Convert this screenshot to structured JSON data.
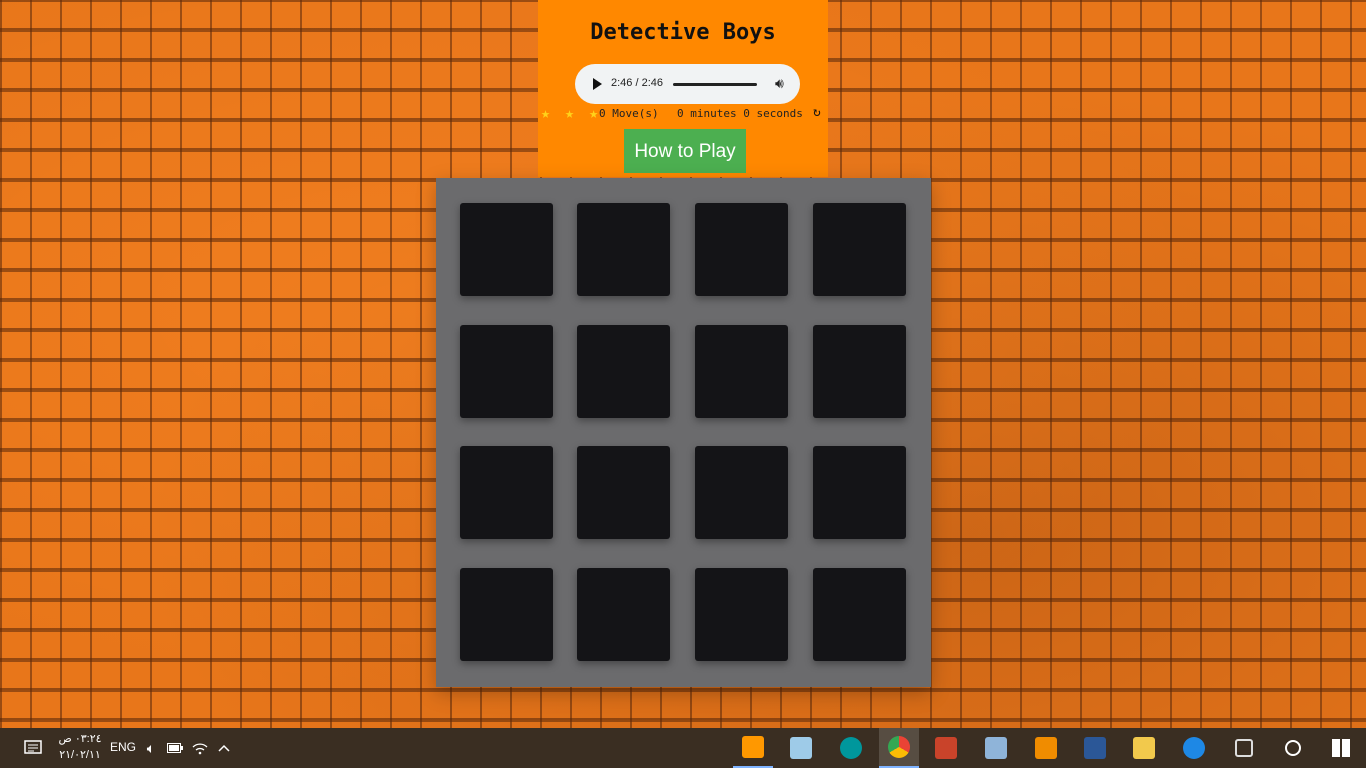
{
  "game": {
    "title": "Detective Boys",
    "audio": {
      "time": "2:46 / 2:46"
    },
    "stars": "★ ★ ★",
    "moves": "0 Move(s)",
    "timer": "0 minutes 0 seconds",
    "restart_icon": "↻",
    "how_to_play": "How to Play",
    "cards": 16
  },
  "taskbar": {
    "time": "٠٣:٢٤ ص",
    "date": "٢١/٠٢/١١",
    "lang": "ENG",
    "apps": [
      {
        "name": "sublime-text",
        "color": "#ff9800"
      },
      {
        "name": "notepad",
        "color": "#9ecbe8"
      },
      {
        "name": "arduino",
        "color": "#00979c"
      },
      {
        "name": "chrome",
        "color": "#4285f4"
      },
      {
        "name": "speaker",
        "color": "#c9432a"
      },
      {
        "name": "paint",
        "color": "#8fb4d9"
      },
      {
        "name": "vlc",
        "color": "#f08c00"
      },
      {
        "name": "word",
        "color": "#2b5797"
      },
      {
        "name": "file-explorer",
        "color": "#f2c94c"
      },
      {
        "name": "edge",
        "color": "#1e88e5"
      },
      {
        "name": "snip",
        "color": "#dddddd"
      },
      {
        "name": "search",
        "color": "#ffffff"
      },
      {
        "name": "windows-start",
        "color": "#ffffff"
      }
    ]
  }
}
